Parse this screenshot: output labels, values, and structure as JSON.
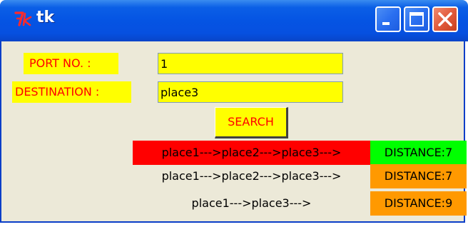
{
  "window": {
    "title": "tk",
    "logo_glyph": "7k",
    "controls": {
      "minimize_icon": "minimize-icon",
      "maximize_icon": "maximize-icon",
      "close_icon": "close-icon"
    },
    "colors": {
      "titlebar": "#0554e3",
      "close_button": "#e25b3c",
      "client_background": "#ece9d8"
    }
  },
  "form": {
    "port_label": "PORT NO. :",
    "port_value": "1",
    "destination_label": "DESTINATION :",
    "destination_value": "place3",
    "search_label": "SEARCH",
    "colors": {
      "label_background": "#ffff00",
      "label_text": "#ff0000",
      "entry_background": "#ffff00"
    }
  },
  "results": [
    {
      "route": "place1--->place2--->place3--->",
      "distance": "DISTANCE:7",
      "route_color": "#ff0000",
      "distance_color": "#00ff00"
    },
    {
      "route": "place1--->place2--->place3--->",
      "distance": "DISTANCE:7",
      "route_color": "",
      "distance_color": "#ff9900"
    },
    {
      "route": "place1--->place3--->",
      "distance": "DISTANCE:9",
      "route_color": "",
      "distance_color": "#ff9900"
    }
  ]
}
